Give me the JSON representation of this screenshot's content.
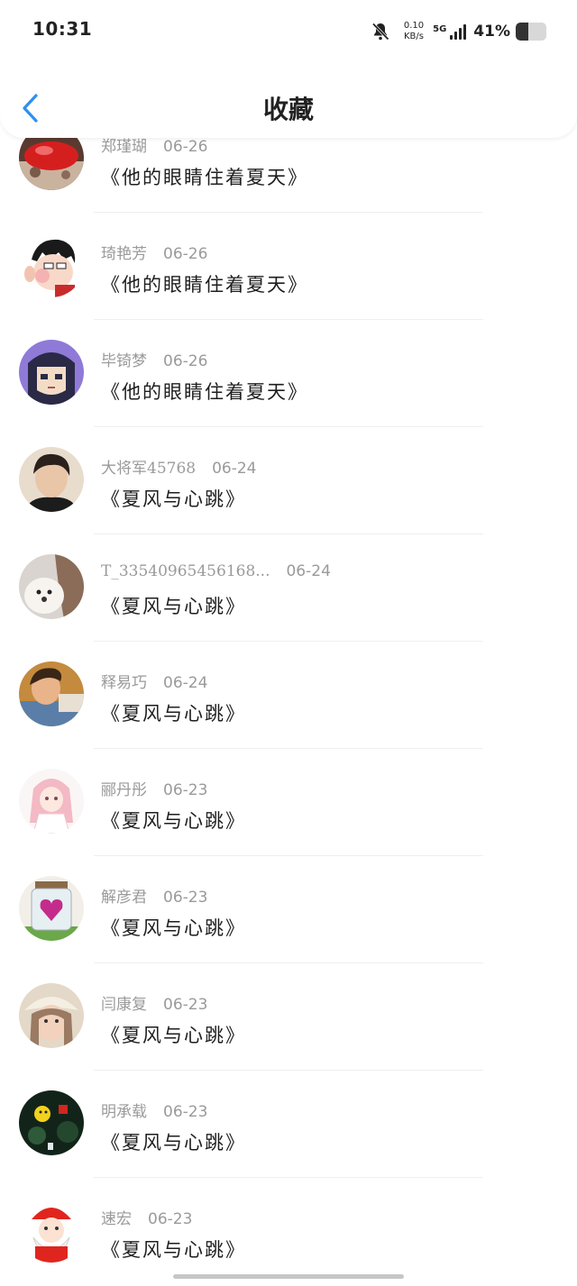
{
  "status_bar": {
    "time": "10:31",
    "net_speed_value": "0.10",
    "net_speed_unit": "KB/s",
    "network": "5G",
    "battery_percent": "41%",
    "battery_level": 0.41
  },
  "header": {
    "title": "收藏",
    "accent_color": "#2e8ff0"
  },
  "items": [
    {
      "name": "郑瑾瑚",
      "date": "06-26",
      "work": "《他的眼睛住着夏天》"
    },
    {
      "name": "琦艳芳",
      "date": "06-26",
      "work": "《他的眼睛住着夏天》"
    },
    {
      "name": "毕锜梦",
      "date": "06-26",
      "work": "《他的眼睛住着夏天》"
    },
    {
      "name": "大将军45768",
      "date": "06-24",
      "work": "《夏风与心跳》"
    },
    {
      "name": "T_33540965456168...",
      "date": "06-24",
      "work": "《夏风与心跳》"
    },
    {
      "name": "释易巧",
      "date": "06-24",
      "work": "《夏风与心跳》"
    },
    {
      "name": "郦丹彤",
      "date": "06-23",
      "work": "《夏风与心跳》"
    },
    {
      "name": "解彦君",
      "date": "06-23",
      "work": "《夏风与心跳》"
    },
    {
      "name": "闫康复",
      "date": "06-23",
      "work": "《夏风与心跳》"
    },
    {
      "name": "明承载",
      "date": "06-23",
      "work": "《夏风与心跳》"
    },
    {
      "name": "速宏",
      "date": "06-23",
      "work": "《夏风与心跳》"
    }
  ]
}
